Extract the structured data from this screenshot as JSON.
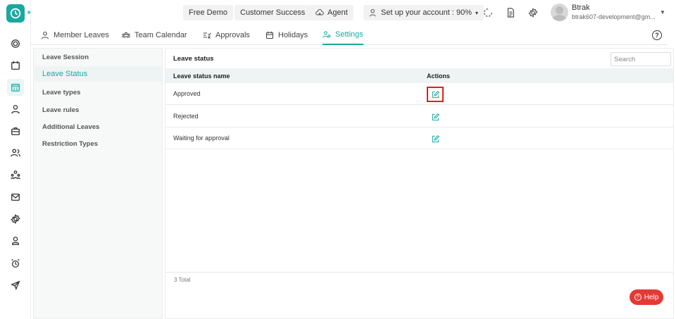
{
  "colors": {
    "accent": "#1aa8a0",
    "highlight": "#e0201a",
    "help": "#e53935"
  },
  "topbar": {
    "free_demo": "Free Demo",
    "customer_success": "Customer Success",
    "agent": "Agent",
    "setup": "Set up your account : 90%",
    "user_name": "Btrak",
    "user_email": "btrak607-development@gm..."
  },
  "tabs": [
    {
      "label": "Member Leaves",
      "icon": "user-icon"
    },
    {
      "label": "Team Calendar",
      "icon": "team-icon"
    },
    {
      "label": "Approvals",
      "icon": "approvals-icon"
    },
    {
      "label": "Holidays",
      "icon": "calendar-icon"
    },
    {
      "label": "Settings",
      "icon": "settings-users-icon",
      "active": true
    }
  ],
  "menu": [
    {
      "label": "Leave Session"
    },
    {
      "label": "Leave Status",
      "active": true
    },
    {
      "label": "Leave types"
    },
    {
      "label": "Leave rules"
    },
    {
      "label": "Additional Leaves"
    },
    {
      "label": "Restriction Types"
    }
  ],
  "panel": {
    "title": "Leave status",
    "search_placeholder": "Search",
    "columns": [
      "Leave status name",
      "Actions"
    ],
    "rows": [
      "Approved",
      "Rejected",
      "Waiting for approval"
    ],
    "total": "3 Total"
  },
  "help": {
    "label": "Help"
  }
}
